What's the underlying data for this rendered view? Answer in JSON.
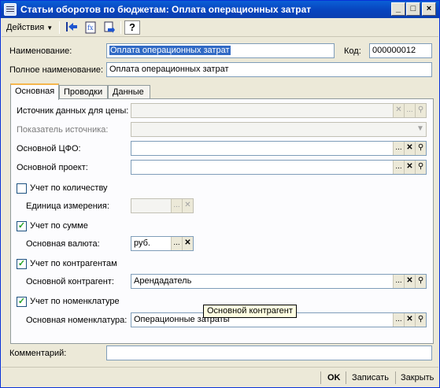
{
  "window": {
    "title": "Статьи оборотов по бюджетам: Оплата операционных затрат",
    "minimize": "_",
    "maximize": "□",
    "close": "×"
  },
  "toolbar": {
    "actions_label": "Действия",
    "icons": [
      "arrow-left-blue-icon",
      "document-formula-icon",
      "swap-arrows-icon",
      "help-icon"
    ],
    "help_glyph": "?"
  },
  "header": {
    "name_label": "Наименование:",
    "name_value": "Оплата операционных затрат",
    "code_label": "Код:",
    "code_value": "000000012",
    "full_name_label": "Полное наименование:",
    "full_name_value": "Оплата операционных затрат"
  },
  "tabs": [
    "Основная",
    "Проводки",
    "Данные"
  ],
  "main": {
    "price_source_label": "Источник данных для цены:",
    "price_source_value": "",
    "source_indicator_label": "Показатель источника:",
    "source_indicator_value": "",
    "cfo_label": "Основной ЦФО:",
    "cfo_value": "",
    "project_label": "Основной проект:",
    "project_value": "",
    "qty_check_label": "Учет по количеству",
    "qty_checked": false,
    "unit_label": "Единица измерения:",
    "unit_value": "",
    "sum_check_label": "Учет по сумме",
    "sum_checked": true,
    "currency_label": "Основная валюта:",
    "currency_value": "руб.",
    "counterparty_check_label": "Учет по контрагентам",
    "counterparty_checked": true,
    "counterparty_label": "Основной контрагент:",
    "counterparty_value": "Арендадатель",
    "nomenclature_check_label": "Учет по номенклатуре",
    "nomenclature_checked": true,
    "nomenclature_label": "Основная номенклатура:",
    "nomenclature_value": "Операционные затраты"
  },
  "tooltip": "Основной контрагент",
  "comment_label": "Комментарий:",
  "comment_value": "",
  "buttons": {
    "ok": "OK",
    "save": "Записать",
    "close": "Закрыть"
  },
  "glyphs": {
    "ellipsis": "...",
    "clear": "✕",
    "search": "⚲",
    "dropdown": "▼",
    "check": "✓"
  }
}
